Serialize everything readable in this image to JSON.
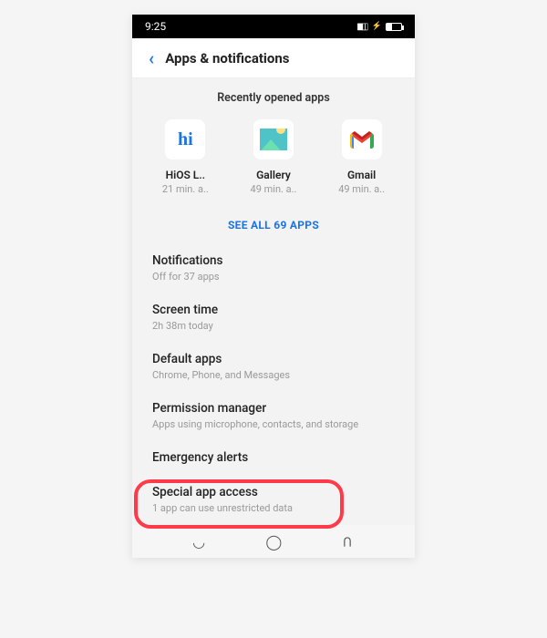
{
  "statusbar": {
    "time": "9:25"
  },
  "header": {
    "title": "Apps & notifications"
  },
  "recent": {
    "heading": "Recently opened apps",
    "apps": [
      {
        "name": "HiOS L..",
        "sub": "21 min. a.."
      },
      {
        "name": "Gallery",
        "sub": "49 min. a.."
      },
      {
        "name": "Gmail",
        "sub": "49 min. a.."
      }
    ],
    "see_all": "SEE ALL 69 APPS"
  },
  "items": [
    {
      "title": "Notifications",
      "sub": "Off for 37 apps"
    },
    {
      "title": "Screen time",
      "sub": "2h 38m today"
    },
    {
      "title": "Default apps",
      "sub": "Chrome, Phone, and Messages"
    },
    {
      "title": "Permission manager",
      "sub": "Apps using microphone, contacts, and storage"
    },
    {
      "title": "Emergency alerts",
      "sub": ""
    },
    {
      "title": "Special app access",
      "sub": "1 app can use unrestricted data"
    }
  ]
}
